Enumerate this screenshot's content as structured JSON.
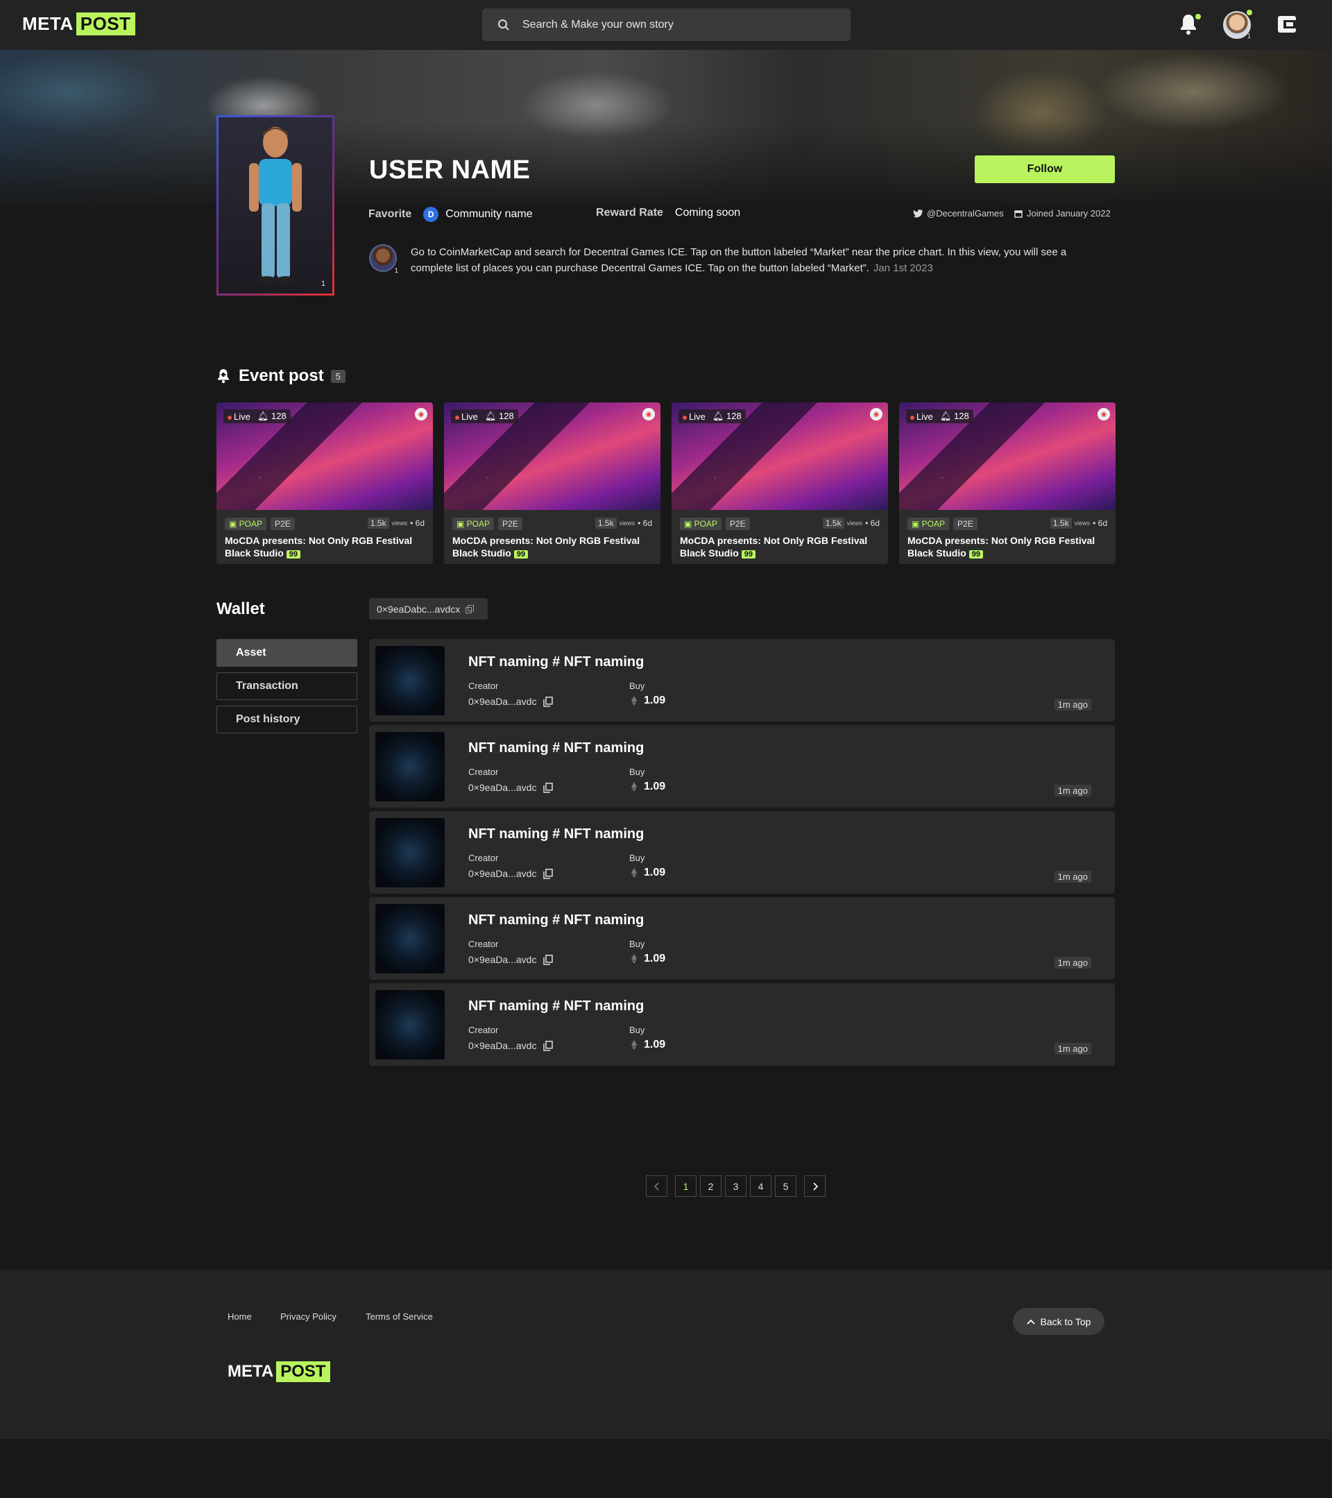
{
  "header": {
    "logo_meta": "META",
    "logo_post": "POST",
    "search_placeholder": "Search & Make your own story",
    "avatar_level": "1"
  },
  "profile": {
    "username": "USER NAME",
    "follow_label": "Follow",
    "avatar_level": "1",
    "favorite_label": "Favorite",
    "community_name": "Community name",
    "reward_label": "Reward Rate",
    "reward_value": "Coming soon",
    "twitter": "@DecentralGames",
    "joined": "Joined January 2022"
  },
  "comment": {
    "avatar_level": "1",
    "line1": "Go to CoinMarketCap and search for Decentral Games ICE. Tap on the button labeled “Market” near the price chart. In this view, you will see a",
    "line2": "complete list of places you can purchase Decentral Games ICE. Tap on the button labeled “Market”.",
    "date": "Jan 1st 2023"
  },
  "events": {
    "title": "Event post",
    "count": "5",
    "cards": [
      {
        "live": "Live",
        "viewers": "128",
        "tag1": "POAP",
        "tag2": "P2E",
        "views": "1.5k",
        "views_label": "views",
        "age": "• 6d",
        "title_line1": "MoCDA presents: Not Only RGB Festival",
        "title_line2": "Black Studio",
        "score": "99"
      },
      {
        "live": "Live",
        "viewers": "128",
        "tag1": "POAP",
        "tag2": "P2E",
        "views": "1.5k",
        "views_label": "views",
        "age": "• 6d",
        "title_line1": "MoCDA presents: Not Only RGB Festival",
        "title_line2": "Black Studio",
        "score": "99"
      },
      {
        "live": "Live",
        "viewers": "128",
        "tag1": "POAP",
        "tag2": "P2E",
        "views": "1.5k",
        "views_label": "views",
        "age": "• 6d",
        "title_line1": "MoCDA presents: Not Only RGB Festival",
        "title_line2": "Black Studio",
        "score": "99"
      },
      {
        "live": "Live",
        "viewers": "128",
        "tag1": "POAP",
        "tag2": "P2E",
        "views": "1.5k",
        "views_label": "views",
        "age": "• 6d",
        "title_line1": "MoCDA presents: Not Only RGB Festival",
        "title_line2": "Black Studio",
        "score": "99"
      }
    ]
  },
  "wallet": {
    "title": "Wallet",
    "address": "0×9eaDabc...avdcx",
    "tabs": [
      "Asset",
      "Transaction",
      "Post history"
    ],
    "active_tab": "Asset",
    "items": [
      {
        "title": "NFT naming # NFT naming",
        "creator_label": "Creator",
        "creator": "0×9eaDa...avdc",
        "buy_label": "Buy",
        "price": "1.09",
        "time": "1m ago"
      },
      {
        "title": "NFT naming # NFT naming",
        "creator_label": "Creator",
        "creator": "0×9eaDa...avdc",
        "buy_label": "Buy",
        "price": "1.09",
        "time": "1m ago"
      },
      {
        "title": "NFT naming # NFT naming",
        "creator_label": "Creator",
        "creator": "0×9eaDa...avdc",
        "buy_label": "Buy",
        "price": "1.09",
        "time": "1m ago"
      },
      {
        "title": "NFT naming # NFT naming",
        "creator_label": "Creator",
        "creator": "0×9eaDa...avdc",
        "buy_label": "Buy",
        "price": "1.09",
        "time": "1m ago"
      },
      {
        "title": "NFT naming # NFT naming",
        "creator_label": "Creator",
        "creator": "0×9eaDa...avdc",
        "buy_label": "Buy",
        "price": "1.09",
        "time": "1m ago"
      }
    ]
  },
  "pagination": {
    "pages": [
      "1",
      "2",
      "3",
      "4",
      "5"
    ],
    "current": "1"
  },
  "footer": {
    "links": [
      "Home",
      "Privacy Policy",
      "Terms of Service"
    ],
    "back_to_top": "Back to Top",
    "logo_meta": "META",
    "logo_post": "POST"
  },
  "colors": {
    "accent": "#b9f45e",
    "background": "#181818",
    "panel": "#2a2a2a"
  }
}
